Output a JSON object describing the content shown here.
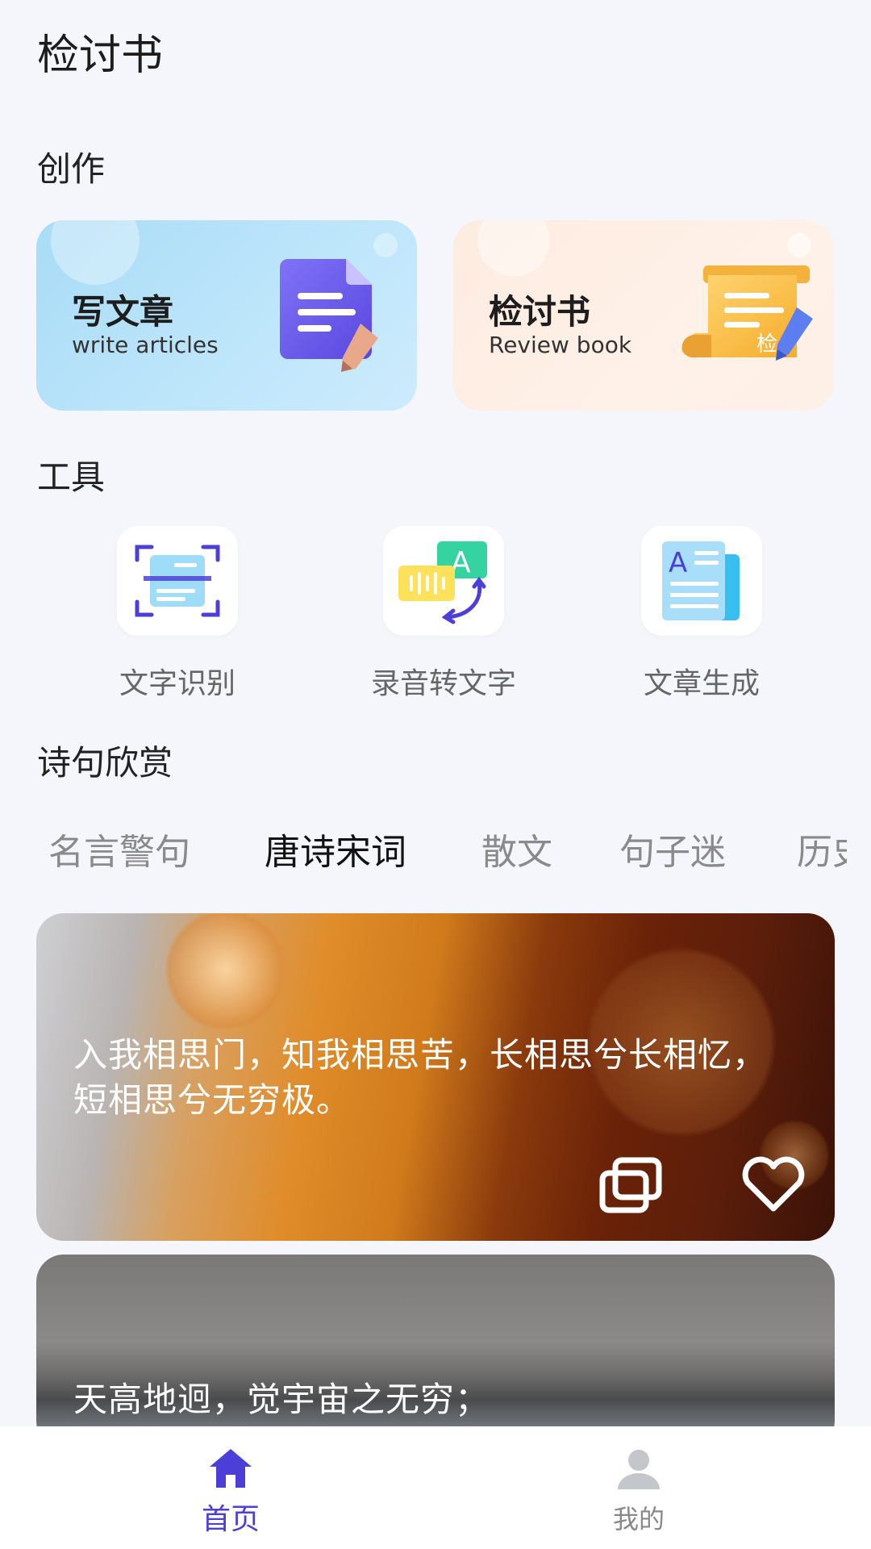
{
  "app": {
    "title": "检讨书"
  },
  "sections": {
    "create": "创作",
    "tools": "工具",
    "poetry": "诗句欣赏"
  },
  "create_cards": [
    {
      "title": "写文章",
      "subtitle": "write articles",
      "icon": "document-pen-icon"
    },
    {
      "title": "检讨书",
      "subtitle": "Review book",
      "icon": "scroll-pen-icon",
      "icon_badge": "检"
    }
  ],
  "tools": [
    {
      "label": "文字识别",
      "icon": "text-scan-icon"
    },
    {
      "label": "录音转文字",
      "icon": "voice-to-text-icon",
      "icon_letter": "A"
    },
    {
      "label": "文章生成",
      "icon": "article-generate-icon",
      "icon_letter": "A"
    }
  ],
  "tabs": [
    {
      "label": "名言警句",
      "active": false
    },
    {
      "label": "唐诗宋词",
      "active": true
    },
    {
      "label": "散文",
      "active": false
    },
    {
      "label": "句子迷",
      "active": false
    },
    {
      "label": "历史",
      "active": false
    }
  ],
  "poems": [
    {
      "text": "入我相思门，知我相思苦，长相思兮长相忆，短相思兮无穷极。"
    },
    {
      "text": "天高地迥，觉宇宙之无穷；"
    }
  ],
  "bottom_nav": [
    {
      "label": "首页",
      "icon": "home-icon",
      "active": true
    },
    {
      "label": "我的",
      "icon": "profile-icon",
      "active": false
    }
  ],
  "colors": {
    "accent": "#4b3fd8",
    "background": "#f5f6fb",
    "write_card": "#b5e0f8",
    "review_card": "#fdeee3"
  }
}
